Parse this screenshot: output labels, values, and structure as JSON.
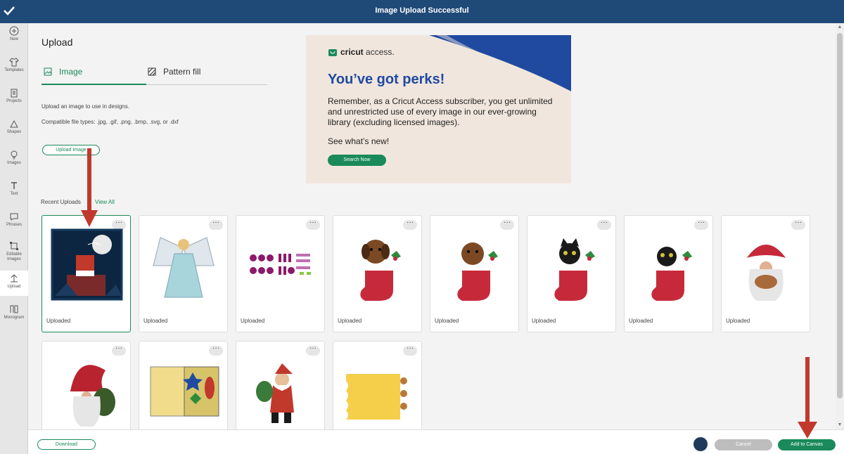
{
  "topbar": {
    "title": "Image Upload Successful"
  },
  "sidebar": {
    "items": [
      {
        "label": "New",
        "icon": "plus-circle-icon"
      },
      {
        "label": "Templates",
        "icon": "shirt-icon"
      },
      {
        "label": "Projects",
        "icon": "clipboard-icon"
      },
      {
        "label": "Shapes",
        "icon": "shapes-icon"
      },
      {
        "label": "Images",
        "icon": "bulb-icon"
      },
      {
        "label": "Text",
        "icon": "text-icon"
      },
      {
        "label": "Phrases",
        "icon": "speech-bubble-icon"
      },
      {
        "label": "Editable Images",
        "icon": "editable-images-icon"
      },
      {
        "label": "Upload",
        "icon": "upload-icon"
      },
      {
        "label": "Monogram",
        "icon": "monogram-icon"
      }
    ]
  },
  "upload": {
    "title": "Upload",
    "tabs": [
      {
        "label": "Image",
        "active": true,
        "icon": "image-icon"
      },
      {
        "label": "Pattern fill",
        "active": false,
        "icon": "pattern-icon"
      }
    ],
    "description": "Upload an image to use in designs.",
    "file_types": "Compatible file types: .jpg, .gif, .png, .bmp, .svg, or .dxf",
    "upload_button": "Upload Image",
    "recent_label": "Recent Uploads",
    "view_all": "View All"
  },
  "promo": {
    "brand": "cricut",
    "brand_suffix": "access.",
    "headline": "You’ve got perks!",
    "body": "Remember, as a Cricut Access subscriber, you get unlimited and unrestricted use of every image in our ever-growing library (excluding licensed images).",
    "whats_new": "See what’s new!",
    "button": "Search Now",
    "colors": {
      "background": "#f1e6dd",
      "accent_blue": "#1f4aa0",
      "green": "#1a8a5a"
    }
  },
  "uploads": [
    {
      "caption": "Uploaded",
      "art": "santa-chimney",
      "selected": true
    },
    {
      "caption": "Uploaded",
      "art": "angel"
    },
    {
      "caption": "Uploaded",
      "art": "purple-pattern"
    },
    {
      "caption": "Uploaded",
      "art": "puppy-stocking"
    },
    {
      "caption": "Uploaded",
      "art": "puppy-stocking-2"
    },
    {
      "caption": "Uploaded",
      "art": "kitten-stocking"
    },
    {
      "caption": "Uploaded",
      "art": "kitten-stocking-2"
    },
    {
      "caption": "Uploaded",
      "art": "gnome-cookies"
    },
    {
      "caption": "",
      "art": "gnome-red"
    },
    {
      "caption": "",
      "art": "ornament-card"
    },
    {
      "caption": "",
      "art": "santa-toys"
    },
    {
      "caption": "",
      "art": "yellow-gingerbread-card"
    }
  ],
  "bottom": {
    "download": "Download",
    "cancel": "Cancel",
    "add": "Add to Canvas"
  },
  "colors": {
    "topbar": "#1f4a77",
    "green": "#1a8a5a",
    "arrow": "#c0392b"
  }
}
